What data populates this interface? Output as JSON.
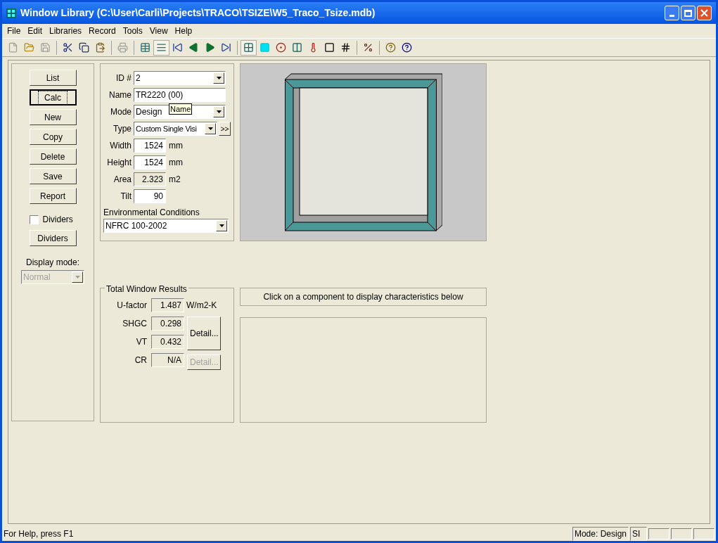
{
  "window": {
    "title": "Window Library (C:\\User\\Carli\\Projects\\TRACO\\TSIZE\\W5_Traco_Tsize.mdb)"
  },
  "menu": [
    "File",
    "Edit",
    "Libraries",
    "Record",
    "Tools",
    "View",
    "Help"
  ],
  "toolbar": [
    {
      "kind": "new",
      "disabled": true,
      "pressed": false
    },
    {
      "kind": "open",
      "disabled": false,
      "pressed": false
    },
    {
      "kind": "save",
      "disabled": true,
      "pressed": false
    },
    {
      "kind": "sep"
    },
    {
      "kind": "cut",
      "disabled": false,
      "pressed": false
    },
    {
      "kind": "copy",
      "disabled": false,
      "pressed": false
    },
    {
      "kind": "paste",
      "disabled": false,
      "pressed": false
    },
    {
      "kind": "sep"
    },
    {
      "kind": "print",
      "disabled": true,
      "pressed": false
    },
    {
      "kind": "sep"
    },
    {
      "kind": "grid",
      "disabled": false,
      "pressed": false
    },
    {
      "kind": "list",
      "disabled": false,
      "pressed": true
    },
    {
      "kind": "first",
      "disabled": false,
      "pressed": false
    },
    {
      "kind": "prev",
      "disabled": false,
      "pressed": false
    },
    {
      "kind": "next",
      "disabled": false,
      "pressed": false
    },
    {
      "kind": "last",
      "disabled": false,
      "pressed": false
    },
    {
      "kind": "sep"
    },
    {
      "kind": "window",
      "disabled": false,
      "pressed": true
    },
    {
      "kind": "glass",
      "disabled": false,
      "pressed": false
    },
    {
      "kind": "balloon",
      "disabled": false,
      "pressed": false
    },
    {
      "kind": "bars",
      "disabled": false,
      "pressed": false
    },
    {
      "kind": "thermo",
      "disabled": false,
      "pressed": false
    },
    {
      "kind": "frame",
      "disabled": false,
      "pressed": false
    },
    {
      "kind": "hash",
      "disabled": false,
      "pressed": false
    },
    {
      "kind": "sep"
    },
    {
      "kind": "fraction",
      "disabled": false,
      "pressed": false
    },
    {
      "kind": "sep"
    },
    {
      "kind": "help",
      "disabled": false,
      "pressed": false
    },
    {
      "kind": "whatsthis",
      "disabled": false,
      "pressed": false
    }
  ],
  "side_buttons": [
    {
      "label": "List",
      "focused": false
    },
    {
      "label": "Calc",
      "focused": true
    },
    {
      "label": "New",
      "focused": false
    },
    {
      "label": "Copy",
      "focused": false
    },
    {
      "label": "Delete",
      "focused": false
    },
    {
      "label": "Save",
      "focused": false
    },
    {
      "label": "Report",
      "focused": false
    }
  ],
  "dividers_checkbox": {
    "label": "Dividers",
    "checked": false
  },
  "dividers_button": "Dividers",
  "display_mode": {
    "label": "Display mode:",
    "value": "Normal",
    "disabled": true
  },
  "form": [
    {
      "kind": "combo",
      "label": "ID #",
      "value": "2"
    },
    {
      "kind": "text",
      "label": "Name",
      "value": "TR2220 (00)"
    },
    {
      "kind": "combo",
      "label": "Mode",
      "value": "Design"
    },
    {
      "kind": "combo_more",
      "label": "Type",
      "value": "Custom Single Visi",
      "button": ">>"
    },
    {
      "kind": "number",
      "label": "Width",
      "value": "1524",
      "unit": "mm",
      "readonly": false
    },
    {
      "kind": "number",
      "label": "Height",
      "value": "1524",
      "unit": "mm",
      "readonly": false
    },
    {
      "kind": "number",
      "label": "Area",
      "value": "2.323",
      "unit": "m2",
      "readonly": true
    },
    {
      "kind": "number",
      "label": "Tilt",
      "value": "90",
      "readonly": false
    }
  ],
  "tooltip": "Name",
  "environment": {
    "label": "Environmental Conditions",
    "value": "NFRC 100-2002"
  },
  "results": {
    "title": "Total Window Results",
    "rows": [
      {
        "label": "U-factor",
        "value": "1.487",
        "unit": "W/m2-K"
      },
      {
        "label": "SHGC",
        "value": "0.298"
      },
      {
        "label": "VT",
        "value": "0.432"
      },
      {
        "label": "CR",
        "value": "N/A"
      }
    ],
    "detail_buttons": [
      {
        "label": "Detail...",
        "disabled": false
      },
      {
        "label": "Detail...",
        "disabled": true
      }
    ]
  },
  "component_hint": "Click on a component to display characteristics below",
  "status_bar": {
    "help": "For Help, press F1",
    "mode": "Mode: Design",
    "units": "SI"
  }
}
